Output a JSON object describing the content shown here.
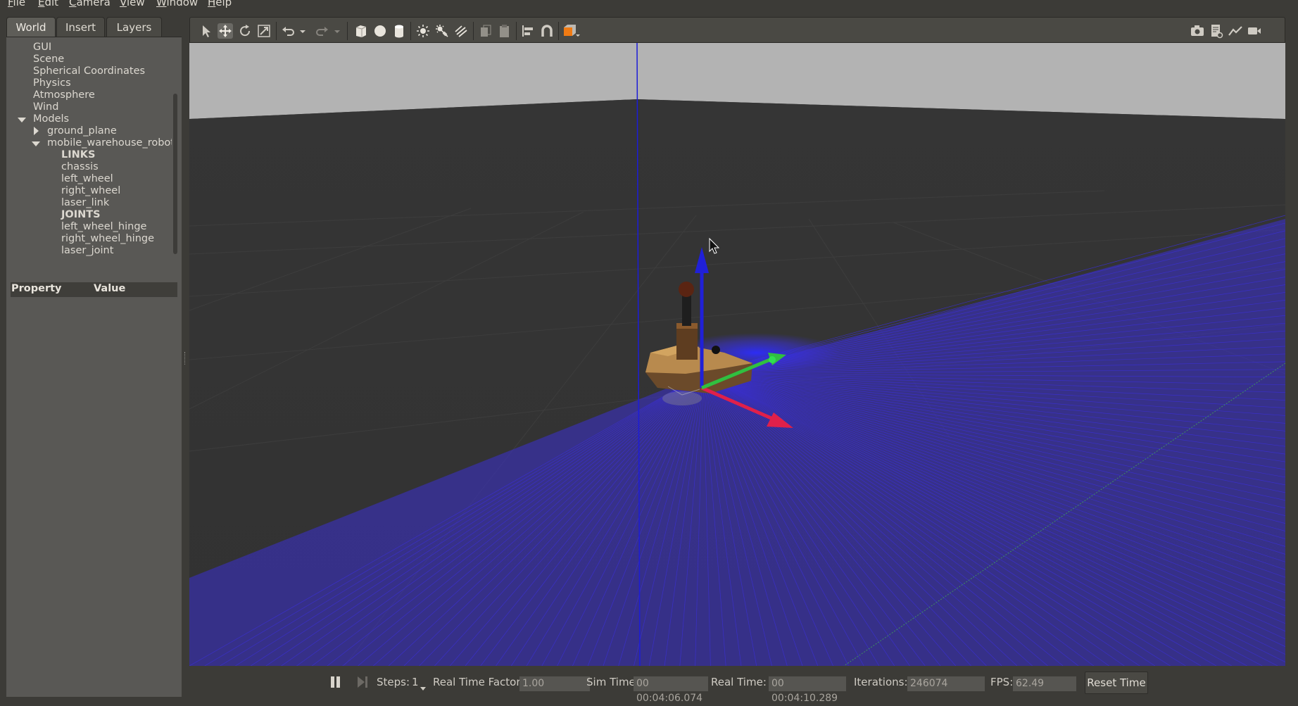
{
  "menu": [
    "File",
    "Edit",
    "Camera",
    "View",
    "Window",
    "Help"
  ],
  "tabs": [
    {
      "label": "World",
      "active": true
    },
    {
      "label": "Insert",
      "active": false
    },
    {
      "label": "Layers",
      "active": false
    }
  ],
  "tree": [
    {
      "label": "GUI",
      "depth": 0,
      "arrow": "none",
      "bold": false
    },
    {
      "label": "Scene",
      "depth": 0,
      "arrow": "none",
      "bold": false
    },
    {
      "label": "Spherical Coordinates",
      "depth": 0,
      "arrow": "none",
      "bold": false
    },
    {
      "label": "Physics",
      "depth": 0,
      "arrow": "none",
      "bold": false
    },
    {
      "label": "Atmosphere",
      "depth": 0,
      "arrow": "none",
      "bold": false
    },
    {
      "label": "Wind",
      "depth": 0,
      "arrow": "none",
      "bold": false
    },
    {
      "label": "Models",
      "depth": 0,
      "arrow": "expanded",
      "bold": false
    },
    {
      "label": "ground_plane",
      "depth": 1,
      "arrow": "collapsed",
      "bold": false
    },
    {
      "label": "mobile_warehouse_robot",
      "depth": 1,
      "arrow": "expanded",
      "bold": false
    },
    {
      "label": "LINKS",
      "depth": 2,
      "arrow": "none",
      "bold": true
    },
    {
      "label": "chassis",
      "depth": 2,
      "arrow": "none",
      "bold": false
    },
    {
      "label": "left_wheel",
      "depth": 2,
      "arrow": "none",
      "bold": false
    },
    {
      "label": "right_wheel",
      "depth": 2,
      "arrow": "none",
      "bold": false
    },
    {
      "label": "laser_link",
      "depth": 2,
      "arrow": "none",
      "bold": false
    },
    {
      "label": "JOINTS",
      "depth": 2,
      "arrow": "none",
      "bold": true
    },
    {
      "label": "left_wheel_hinge",
      "depth": 2,
      "arrow": "none",
      "bold": false
    },
    {
      "label": "right_wheel_hinge",
      "depth": 2,
      "arrow": "none",
      "bold": false
    },
    {
      "label": "laser_joint",
      "depth": 2,
      "arrow": "none",
      "bold": false
    }
  ],
  "properties": {
    "col_property": "Property",
    "col_value": "Value"
  },
  "toolbar": {
    "tools": [
      "select-arrow-icon",
      "translate-icon",
      "rotate-icon",
      "scale-icon",
      "undo-icon",
      "undo-dropdown-icon",
      "redo-icon",
      "redo-dropdown-icon",
      "box-shape-icon",
      "sphere-shape-icon",
      "cylinder-shape-icon",
      "point-light-icon",
      "spot-light-icon",
      "directional-light-icon",
      "copy-icon",
      "paste-icon",
      "align-icon",
      "snap-icon",
      "view-angle-icon"
    ],
    "right_tools": [
      "screenshot-icon",
      "log-icon",
      "plot-icon",
      "record-video-icon"
    ],
    "active_tool": "translate-icon"
  },
  "status": {
    "steps_label": "Steps:",
    "steps_value": "1",
    "rtf_label": "Real Time Factor:",
    "rtf_value": "1.00",
    "sim_time_label": "Sim Time:",
    "sim_time_value": "00 00:04:06.074",
    "real_time_label": "Real Time:",
    "real_time_value": "00 00:04:10.289",
    "iterations_label": "Iterations:",
    "iterations_value": "246074",
    "fps_label": "FPS:",
    "fps_value": "62.49",
    "reset_label": "Reset Time"
  },
  "colors": {
    "laser_scan": "#3a2fcf",
    "axis_x": "#e0204a",
    "axis_y": "#30c040",
    "axis_z": "#2020d0",
    "sky": "#b2b2b2",
    "ground": "#343434"
  }
}
